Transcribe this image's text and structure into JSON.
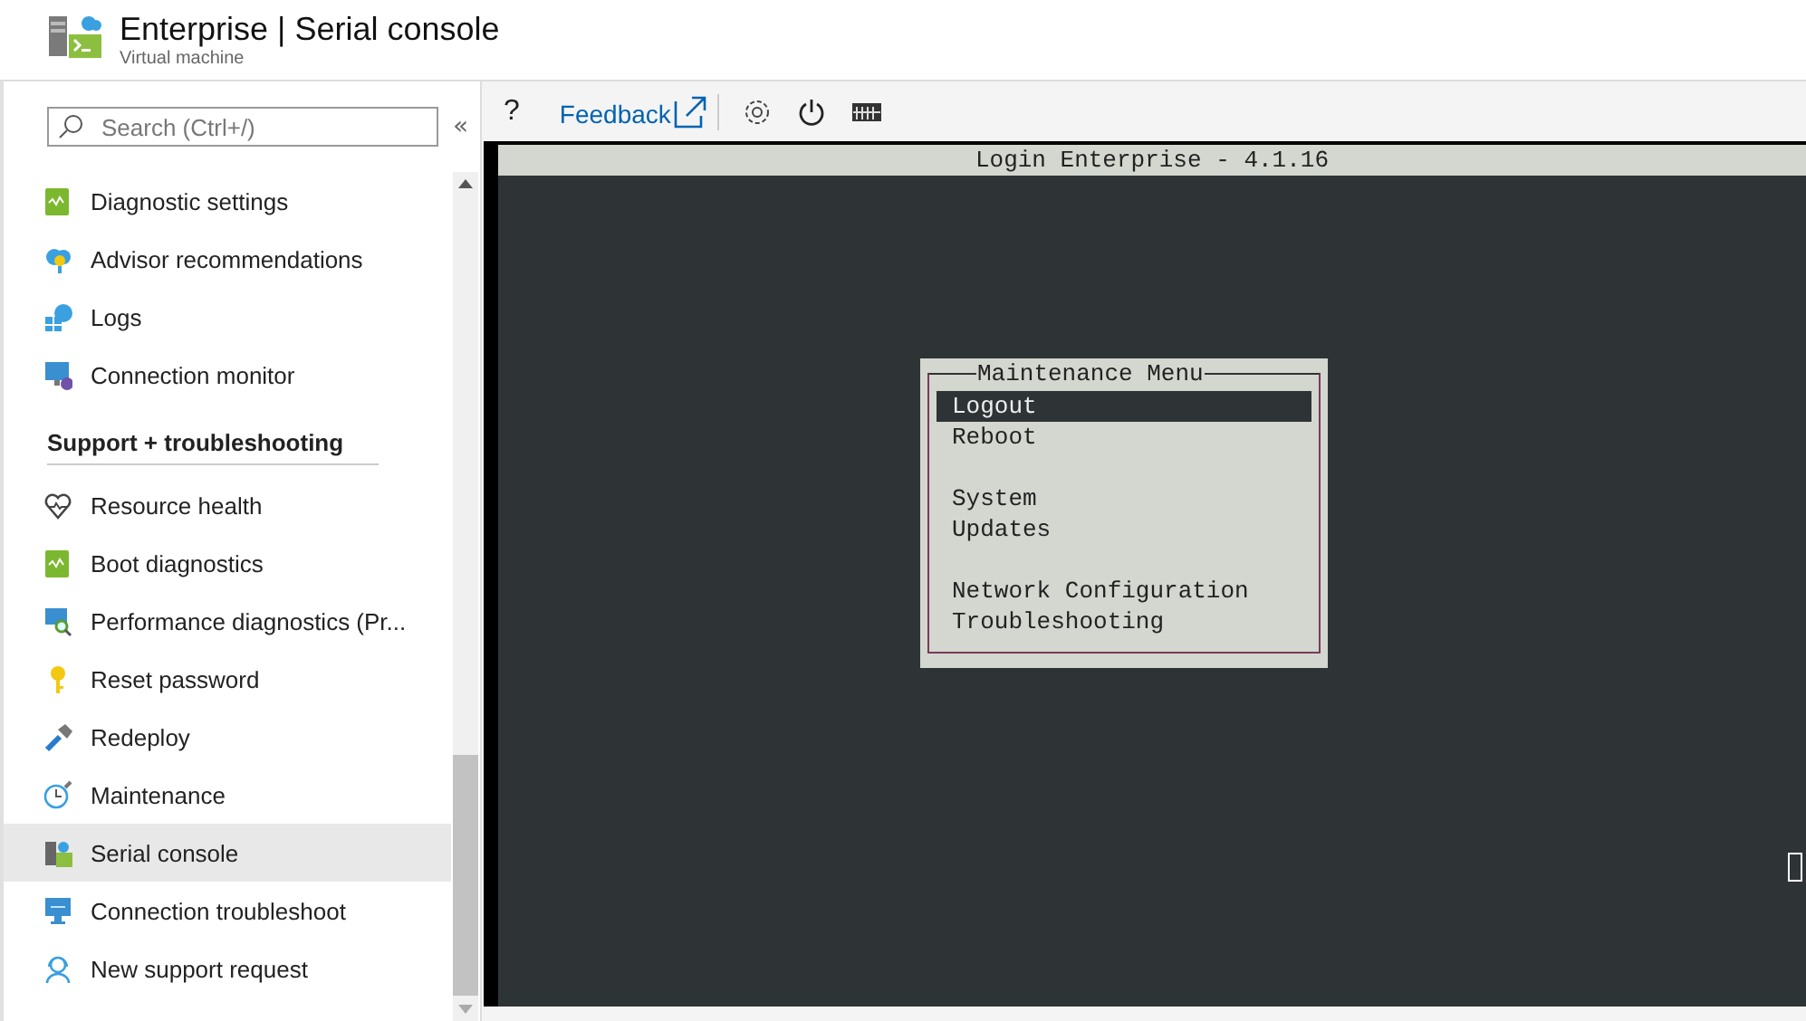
{
  "header": {
    "title": "Enterprise | Serial console",
    "subtitle": "Virtual machine"
  },
  "sidebar": {
    "search": {
      "placeholder": "Search (Ctrl+/)"
    },
    "collapse": "«",
    "sections": [
      {
        "items": [
          {
            "label": "Diagnostic settings",
            "selected": false
          },
          {
            "label": "Advisor recommendations",
            "selected": false
          },
          {
            "label": "Logs",
            "selected": false
          },
          {
            "label": "Connection monitor",
            "selected": false
          }
        ]
      },
      {
        "heading": "Support + troubleshooting",
        "items": [
          {
            "label": "Resource health",
            "selected": false
          },
          {
            "label": "Boot diagnostics",
            "selected": false
          },
          {
            "label": "Performance diagnostics (Pr...",
            "selected": false
          },
          {
            "label": "Reset password",
            "selected": false
          },
          {
            "label": "Redeploy",
            "selected": false
          },
          {
            "label": "Maintenance",
            "selected": false
          },
          {
            "label": "Serial console",
            "selected": true
          },
          {
            "label": "Connection troubleshoot",
            "selected": false
          },
          {
            "label": "New support request",
            "selected": false
          }
        ]
      }
    ]
  },
  "toolbar": {
    "help": "?",
    "feedback": "Feedback"
  },
  "terminal": {
    "title": "Login Enterprise - 4.1.16",
    "menu": {
      "title": "Maintenance Menu",
      "groups": [
        [
          {
            "label": "Logout",
            "selected": true
          },
          {
            "label": "Reboot",
            "selected": false
          }
        ],
        [
          {
            "label": "System",
            "selected": false
          },
          {
            "label": "Updates",
            "selected": false
          }
        ],
        [
          {
            "label": "Network Configuration",
            "selected": false
          },
          {
            "label": "Troubleshooting",
            "selected": false
          }
        ]
      ]
    }
  }
}
